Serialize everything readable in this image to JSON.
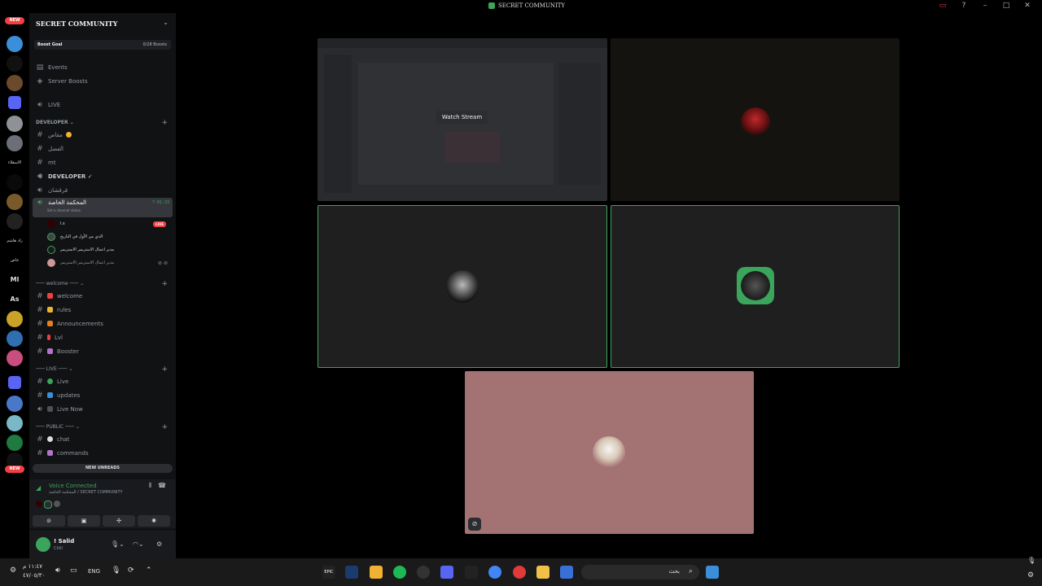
{
  "window": {
    "title": "SECRET COMMUNITY",
    "controls": [
      "▭",
      "?",
      "–",
      "□",
      "✕"
    ]
  },
  "server_rail": {
    "new_top": "NEW",
    "new_bottom": "NEW",
    "texts": [
      "الاسقلاء",
      "زاد هاشم",
      "خاص",
      "Ml",
      "As"
    ]
  },
  "server": {
    "name": "SECRET COMMUNITY",
    "boost_goal_label": "Boost Goal",
    "boost_goal_value": "0/28 Boosts"
  },
  "nav": {
    "events": "Events",
    "server_boosts": "Server Boosts"
  },
  "channels_top": [
    {
      "icon": "speaker-icon",
      "label": "LIVE"
    }
  ],
  "category_developer": "DEVELOPER",
  "developer_channels": [
    {
      "icon": "hash-icon",
      "label": "مقاص"
    },
    {
      "icon": "hash-icon",
      "label": "الفصل"
    },
    {
      "icon": "hash-icon",
      "label": "mt"
    },
    {
      "icon": "speaker-icon",
      "label": "DEVELOPER ✓"
    },
    {
      "icon": "speaker-icon",
      "label": "قرقشان"
    }
  ],
  "active_voice": {
    "label": "المحكمة الخاصة",
    "timer": "7:01:33",
    "status": "Set a channel status",
    "live_badge": "LIVE",
    "users": [
      {
        "name": "l.s"
      },
      {
        "name": "الذي من الأول في التاريخ"
      },
      {
        "name": "مدير اعمال الاستريمر الاستريمر"
      },
      {
        "name": "مدير اعمال الاستريمر الاستريمر"
      }
    ]
  },
  "category_welcome": "welcome",
  "welcome_channels": [
    {
      "label": "welcome"
    },
    {
      "label": "rules"
    },
    {
      "label": "Announcements"
    },
    {
      "label": "Lvl"
    },
    {
      "label": "Booster"
    }
  ],
  "category_live": "LIVE",
  "live_channels": [
    {
      "label": "Live"
    },
    {
      "label": "updates"
    },
    {
      "label": "Live Now"
    }
  ],
  "category_public": "PUBLIC",
  "public_channels": [
    {
      "label": "chat"
    },
    {
      "label": "commands"
    }
  ],
  "new_unreads": "NEW UNREADS",
  "voice_panel": {
    "status": "Voice Connected",
    "location": "المحكمة الخاصة / SECRET COMMUNITY"
  },
  "user": {
    "name": "! Salid",
    "status": "Chill"
  },
  "stage": {
    "watch_stream": "Watch Stream"
  },
  "taskbar": {
    "time": "١١:٤٧ م",
    "date": "٤٧/٠٥/٣٠",
    "lang": "ENG",
    "search_placeholder": "بحث"
  },
  "colors": {
    "accent_green": "#3ba55c",
    "live_red": "#f23f43",
    "tile_pink": "#a37373"
  }
}
